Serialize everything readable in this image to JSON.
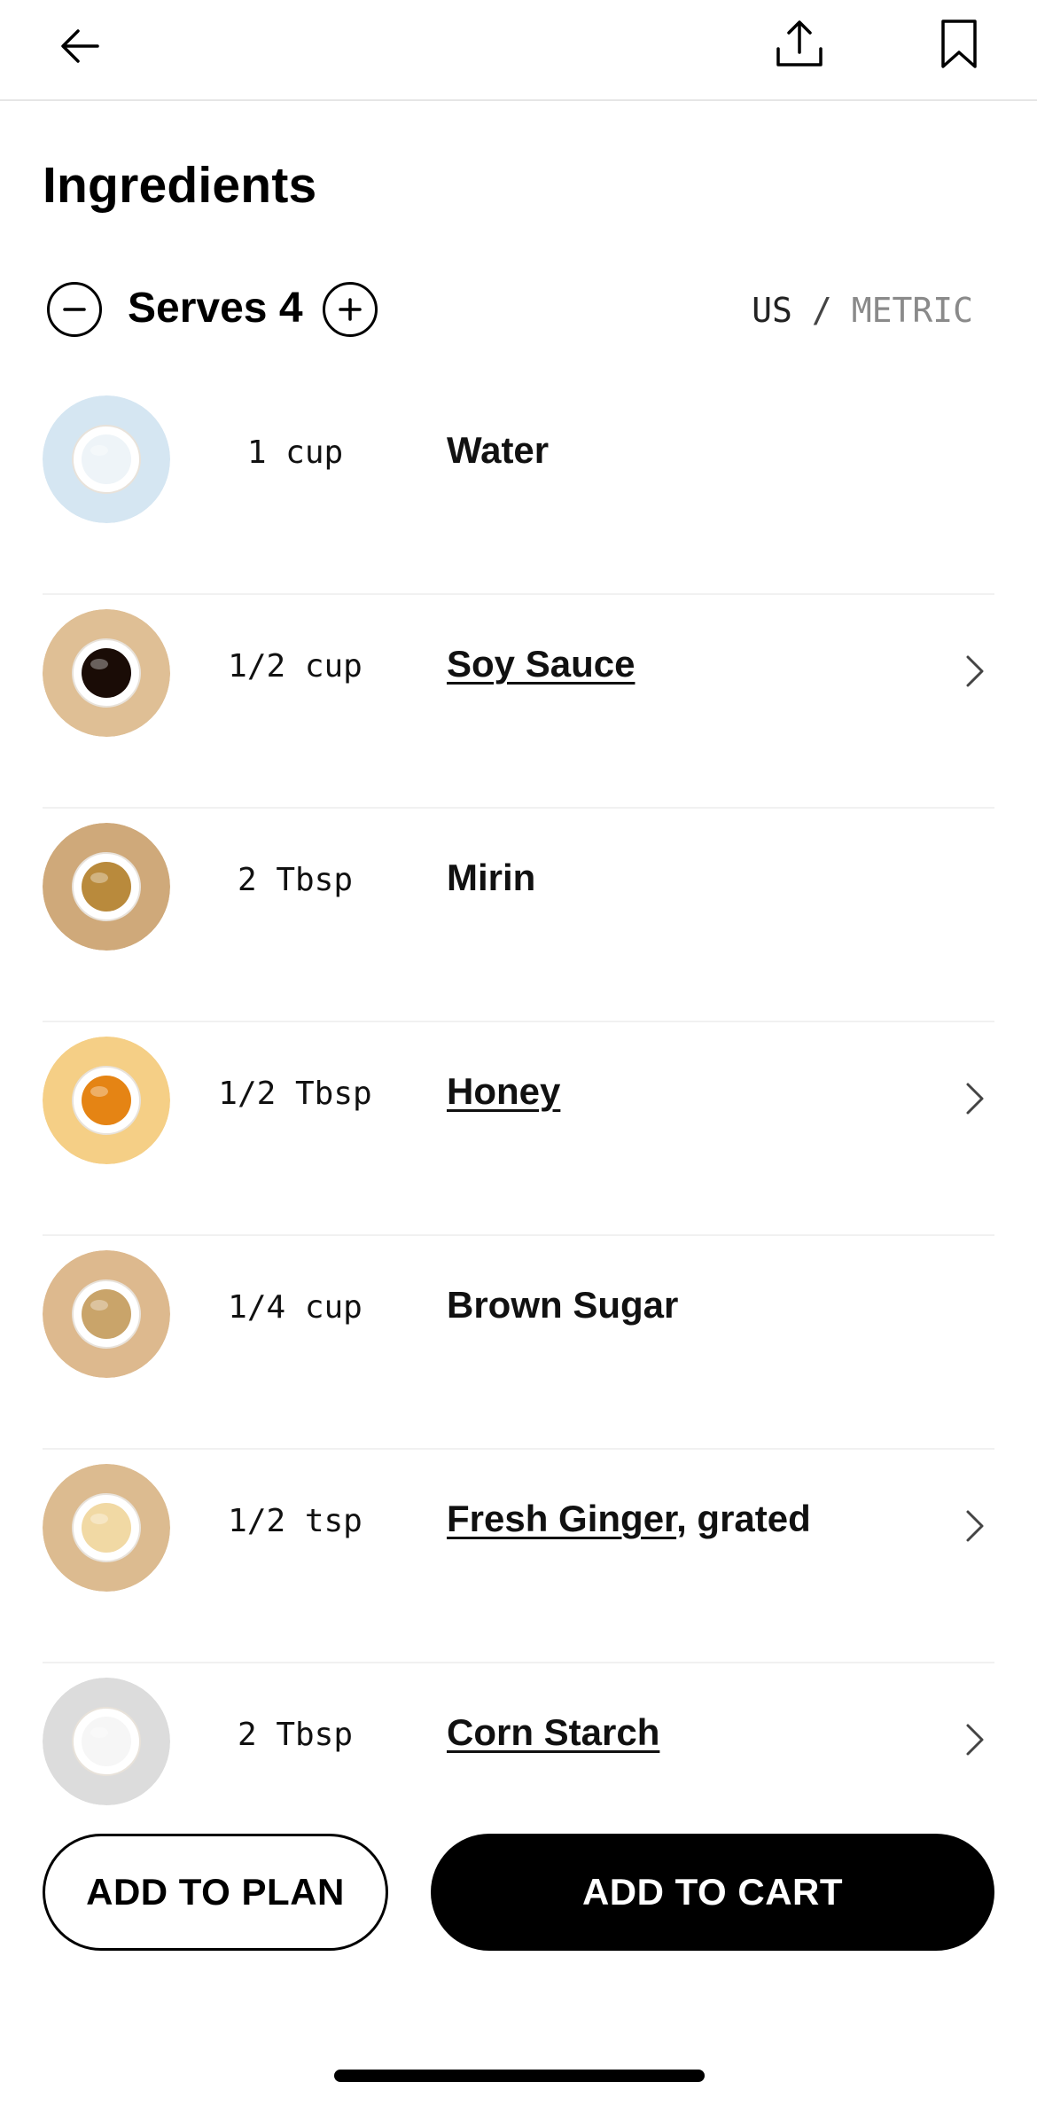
{
  "header": {
    "back_icon": "arrow-left-icon",
    "share_icon": "share-upload-icon",
    "bookmark_icon": "bookmark-icon"
  },
  "title": "Ingredients",
  "serves": {
    "label": "Serves 4",
    "decrease_icon": "minus-circle-icon",
    "increase_icon": "plus-circle-icon"
  },
  "units": {
    "us": "US",
    "separator": "/",
    "metric": "METRIC",
    "selected": "US"
  },
  "ingredients": [
    {
      "qty": "1 cup",
      "name": "Water",
      "suffix": "",
      "linked": false,
      "thumb_bg": "#d5e6f2",
      "thumb_fill": "#eef4f8"
    },
    {
      "qty": "1/2 cup",
      "name": "Soy Sauce",
      "suffix": "",
      "linked": true,
      "thumb_bg": "#dfbf95",
      "thumb_fill": "#1a0c06"
    },
    {
      "qty": "2 Tbsp",
      "name": "Mirin",
      "suffix": "",
      "linked": false,
      "thumb_bg": "#cfa97a",
      "thumb_fill": "#b98a3c"
    },
    {
      "qty": "1/2 Tbsp",
      "name": "Honey",
      "suffix": "",
      "linked": true,
      "thumb_bg": "#f5cf86",
      "thumb_fill": "#e58414"
    },
    {
      "qty": "1/4 cup",
      "name": "Brown Sugar",
      "suffix": "",
      "linked": false,
      "thumb_bg": "#ddb98e",
      "thumb_fill": "#c9a46a"
    },
    {
      "qty": "1/2 tsp",
      "name": "Fresh Ginger",
      "suffix": ", grated",
      "linked": true,
      "thumb_bg": "#dcbb90",
      "thumb_fill": "#f1d9a4"
    },
    {
      "qty": "2 Tbsp",
      "name": "Corn Starch",
      "suffix": "",
      "linked": true,
      "thumb_bg": "#dcdcdc",
      "thumb_fill": "#f6f6f6"
    }
  ],
  "actions": {
    "add_to_plan": "ADD TO PLAN",
    "add_to_cart": "ADD TO CART"
  }
}
